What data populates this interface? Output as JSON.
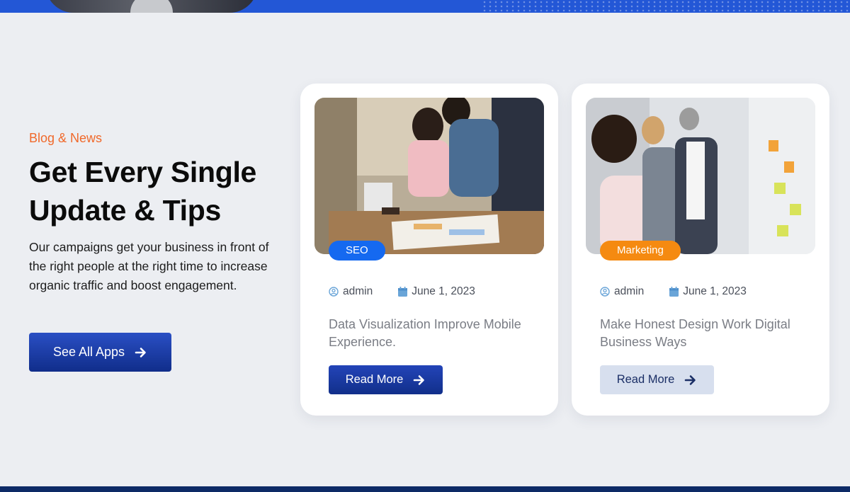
{
  "section": {
    "eyebrow": "Blog & News",
    "heading_line1": "Get Every Single",
    "heading_line2": "Update & Tips",
    "description": "Our campaigns get your business in front of the right people at the right time to increase organic traffic and boost engagement.",
    "cta_label": "See All Apps"
  },
  "posts": [
    {
      "tag": "SEO",
      "tag_color": "#1569f0",
      "author": "admin",
      "date": "June 1, 2023",
      "title": "Data Visualization Improve Mobile Experience.",
      "button_label": "Read More"
    },
    {
      "tag": "Marketing",
      "tag_color": "#f58a11",
      "author": "admin",
      "date": "June 1, 2023",
      "title": "Make Honest Design Work Digital Business Ways",
      "button_label": "Read More"
    }
  ],
  "colors": {
    "accent_orange": "#f0692b",
    "primary_blue": "#1d3fae",
    "page_bg": "#eceef2"
  },
  "icons": {
    "author": "user-circle-icon",
    "date": "calendar-icon",
    "arrow": "arrow-right-icon"
  }
}
